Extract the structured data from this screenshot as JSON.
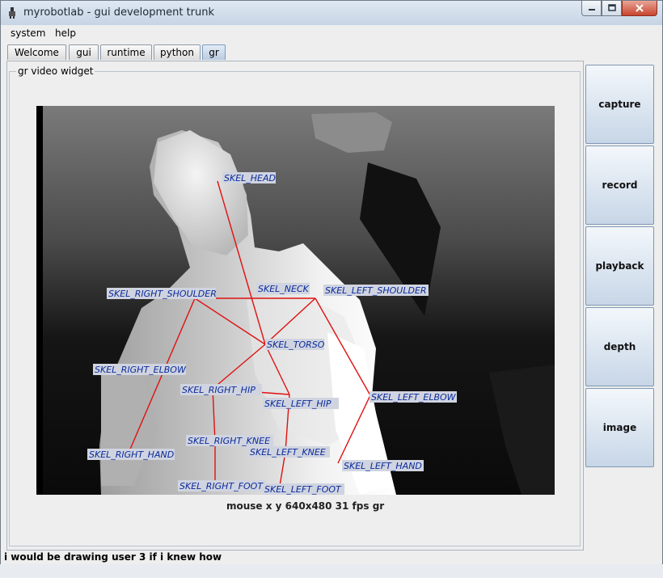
{
  "window": {
    "title": "myrobotlab - gui development trunk",
    "controls": [
      "minimize-icon",
      "maximize-icon",
      "close-icon"
    ]
  },
  "menu": {
    "items": [
      "system",
      "help"
    ]
  },
  "tabs": [
    {
      "label": "Welcome",
      "active": false
    },
    {
      "label": "gui",
      "active": false
    },
    {
      "label": "runtime",
      "active": false
    },
    {
      "label": "python",
      "active": false
    },
    {
      "label": "gr",
      "active": true
    }
  ],
  "panel": {
    "group_title": "gr  video widget",
    "video_status": "mouse x y  640x480  31 fps  gr"
  },
  "skeleton": {
    "labels": [
      "SKEL_HEAD",
      "SKEL_NECK",
      "SKEL_RIGHT_SHOULDER",
      "SKEL_LEFT_SHOULDER",
      "SKEL_TORSO",
      "SKEL_RIGHT_ELBOW",
      "SKEL_RIGHT_HIP",
      "SKEL_LEFT_HIP",
      "SKEL_LEFT_ELBOW",
      "SKEL_RIGHT_KNEE",
      "SKEL_LEFT_KNEE",
      "SKEL_RIGHT_HAND",
      "SKEL_LEFT_HAND",
      "SKEL_RIGHT_FOOT",
      "SKEL_LEFT_FOOT"
    ],
    "line_color": "#e01010",
    "label_color": "#0a2a9a"
  },
  "side_buttons": [
    "capture",
    "record",
    "playback",
    "depth",
    "image"
  ],
  "status_bar": {
    "text": "i would be drawing user 3 if i knew how"
  }
}
